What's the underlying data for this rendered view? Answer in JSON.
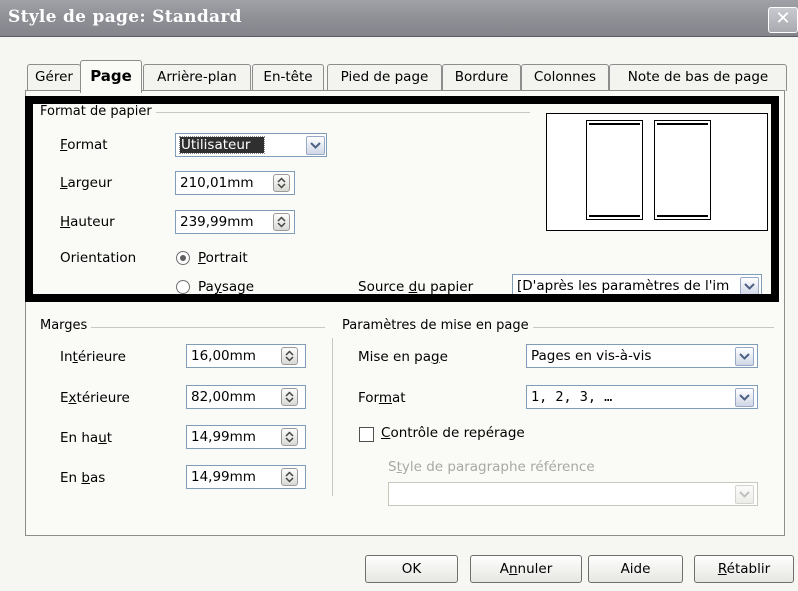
{
  "window": {
    "title": "Style de page: Standard",
    "close_glyph": "✕"
  },
  "tabs": [
    {
      "label": "Gérer"
    },
    {
      "label": "Page"
    },
    {
      "label": "Arrière-plan"
    },
    {
      "label": "En-tête"
    },
    {
      "label": "Pied de page"
    },
    {
      "label": "Bordure"
    },
    {
      "label": "Colonnes"
    },
    {
      "label": "Note de bas de page"
    }
  ],
  "active_tab": "Page",
  "paper_format": {
    "group_label": "Format de papier",
    "format_label_u": "F",
    "format_label_rest": "ormat",
    "format_value": "Utilisateur",
    "width_label_u": "L",
    "width_label_rest": "argeur",
    "width_value": "210,01mm",
    "height_label_u": "H",
    "height_label_rest": "auteur",
    "height_value": "239,99mm",
    "orientation_label": "Orientation",
    "portrait_u": "P",
    "portrait_rest": "ortrait",
    "landscape_pre": "Pa",
    "landscape_u": "y",
    "landscape_rest": "sage",
    "orientation_selected": "portrait",
    "source_pre": "Source ",
    "source_u": "d",
    "source_rest": "u papier",
    "source_value": "[D'après les paramètres de l'im"
  },
  "margins": {
    "group_label": "Marges",
    "inner_pre": "In",
    "inner_u": "t",
    "inner_rest": "érieure",
    "inner_value": "16,00mm",
    "outer_pre": "E",
    "outer_u": "x",
    "outer_rest": "térieure",
    "outer_value": "82,00mm",
    "top_pre": "En ha",
    "top_u": "u",
    "top_rest": "t",
    "top_value": "14,99mm",
    "bottom_pre": "En ",
    "bottom_u": "b",
    "bottom_rest": "as",
    "bottom_value": "14,99mm"
  },
  "layout": {
    "group_label": "Paramètres de mise en page",
    "mise_pre": "Mise en pa",
    "mise_u": "g",
    "mise_rest": "e",
    "mise_value": "Pages en vis-à-vis",
    "format_pre": "For",
    "format_u": "m",
    "format_rest": "at",
    "format_value": "1, 2, 3, …",
    "register_u": "C",
    "register_rest": "ontrôle de repérage",
    "register_checked": false,
    "ref_pre": "S",
    "ref_u": "t",
    "ref_rest": "yle de paragraphe référence",
    "ref_value": ""
  },
  "buttons": {
    "ok": "OK",
    "cancel_pre": "A",
    "cancel_u": "n",
    "cancel_rest": "nuler",
    "help": "Aide",
    "reset_u": "R",
    "reset_rest": "établir"
  },
  "colors": {
    "titlebar": "#8f9096",
    "highlight": "#2f2f2f",
    "frame": "#000000"
  },
  "icons": [
    "close-icon",
    "spin-icon",
    "dropdown-arrow-icon",
    "page-preview-icon"
  ]
}
